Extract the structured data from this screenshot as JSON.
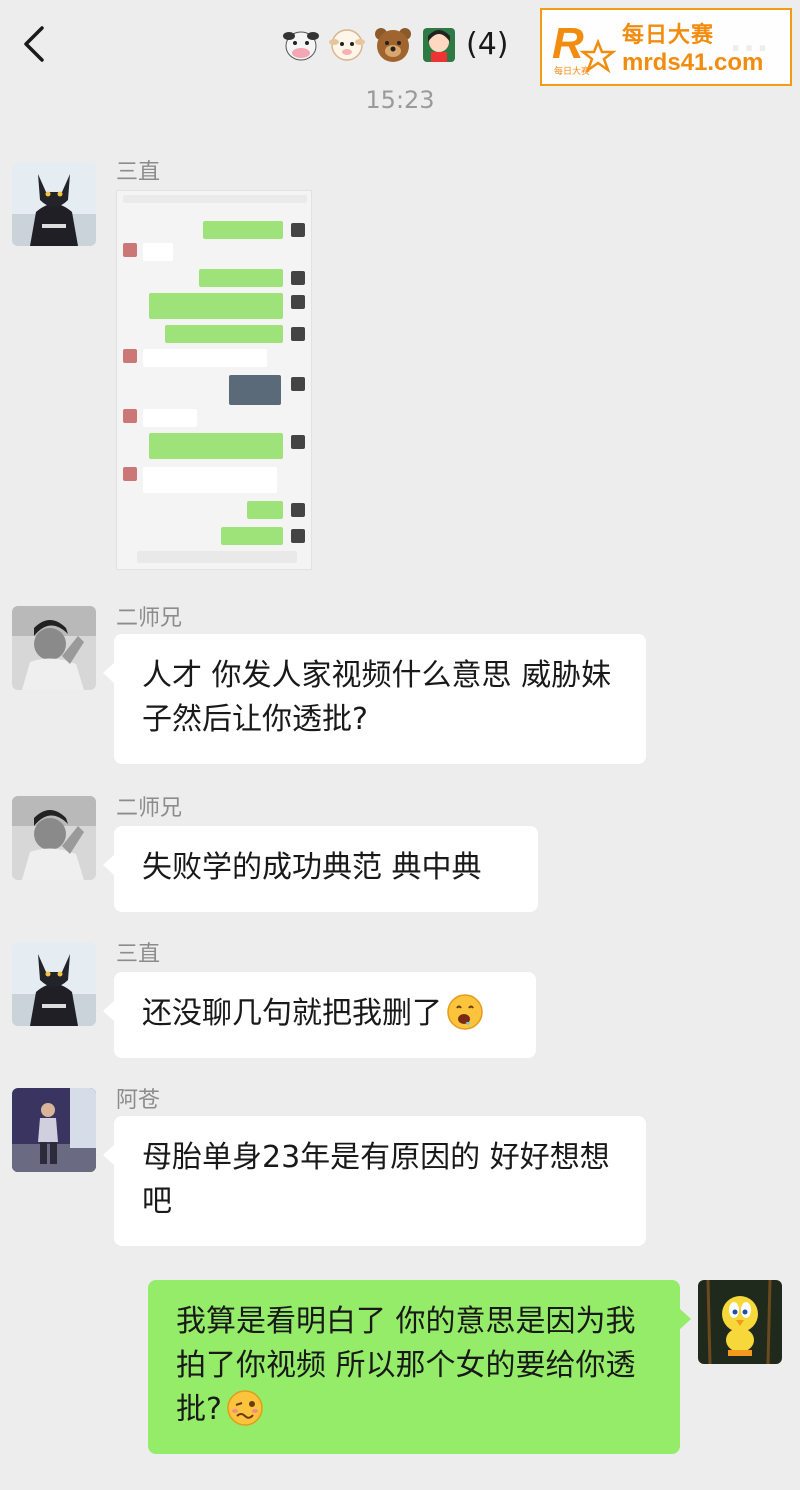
{
  "header": {
    "title_count": "(4)",
    "title_emojis": [
      "cow-emoji",
      "sheep-emoji",
      "bear-emoji",
      "girl-emoji"
    ],
    "back_icon": "chevron-left-icon",
    "more_label": "..."
  },
  "watermark": {
    "cn_text": "每日大赛",
    "url": "mrds41.com",
    "logo_letter": "R",
    "logo_caption": "每日大赛"
  },
  "timestamp": "15:23",
  "messages": [
    {
      "sender": "三直",
      "type": "image",
      "content_icon": "chat-screenshot-image"
    },
    {
      "sender": "二师兄",
      "type": "text",
      "text": "人才 你发人家视频什么意思 威胁妹子然后让你透批?"
    },
    {
      "sender": "二师兄",
      "type": "text",
      "text": "失败学的成功典范 典中典"
    },
    {
      "sender": "三直",
      "type": "text",
      "text": "还没聊几句就把我删了",
      "emoji": "drooling-emoji"
    },
    {
      "sender": "阿苍",
      "type": "text",
      "text": "母胎单身23年是有原因的 好好想想吧"
    },
    {
      "sender": "me",
      "type": "text",
      "text": "我算是看明白了 你的意思是因为我拍了你视频 所以那个女的要给你透批?",
      "emoji": "woozy-emoji"
    }
  ],
  "colors": {
    "background": "#ededed",
    "bubble_incoming": "#ffffff",
    "bubble_outgoing": "#95ec69",
    "watermark_accent": "#f28c0f"
  }
}
